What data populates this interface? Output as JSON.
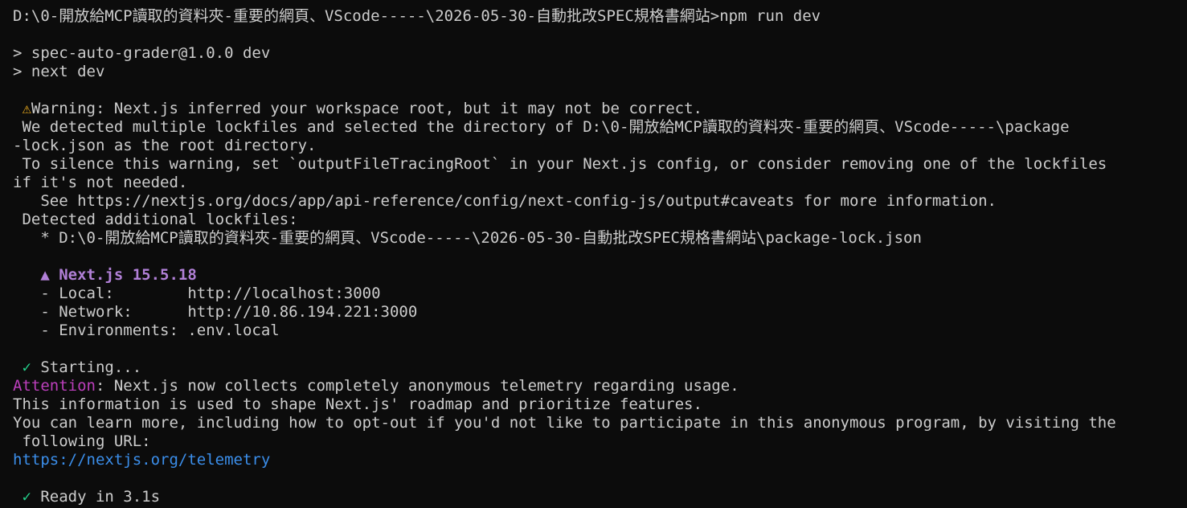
{
  "window": {
    "background": "#0c0c0c",
    "foreground": "#cccccc"
  },
  "colors": {
    "warning_icon": "#f2b01e",
    "next_brand": "#b180d7",
    "success_check": "#23d18b",
    "attention": "#bc3fbc",
    "link": "#3b8eea"
  },
  "terminal": {
    "command_line": "D:\\0-開放給MCP讀取的資料夾-重要的網頁、VScode-----\\2026-05-30-自動批改SPEC規格書網站>npm run dev",
    "script_line_1": "> spec-auto-grader@1.0.0 dev",
    "script_line_2": "> next dev",
    "warning": {
      "icon": "warning-icon",
      "icon_glyph": "⚠",
      "title": "Warning: Next.js inferred your workspace root, but it may not be correct.",
      "line_1": " We detected multiple lockfiles and selected the directory of D:\\0-開放給MCP讀取的資料夾-重要的網頁、VScode-----\\package",
      "line_2": "-lock.json as the root directory.",
      "line_3": " To silence this warning, set `outputFileTracingRoot` in your Next.js config, or consider removing one of the lockfiles",
      "line_4": "if it's not needed.",
      "line_5": "   See https://nextjs.org/docs/app/api-reference/config/next-config-js/output#caveats for more information.",
      "line_6": " Detected additional lockfiles:",
      "line_7": "   * D:\\0-開放給MCP讀取的資料夾-重要的網頁、VScode-----\\2026-05-30-自動批改SPEC規格書網站\\package-lock.json"
    },
    "next_info": {
      "brand": "   ▲ Next.js 15.5.18",
      "local": "   - Local:        http://localhost:3000",
      "network": "   - Network:      http://10.86.194.221:3000",
      "environments": "   - Environments: .env.local"
    },
    "starting": {
      "check_glyph": " ✓",
      "text": " Starting..."
    },
    "telemetry": {
      "attention_label": "Attention",
      "attention_rest": ": Next.js now collects completely anonymous telemetry regarding usage.",
      "line_2": "This information is used to shape Next.js' roadmap and prioritize features.",
      "line_3": "You can learn more, including how to opt-out if you'd not like to participate in this anonymous program, by visiting the",
      "line_4": " following URL:",
      "url": "https://nextjs.org/telemetry"
    },
    "ready": {
      "check_glyph": " ✓",
      "text": " Ready in 3.1s"
    }
  }
}
